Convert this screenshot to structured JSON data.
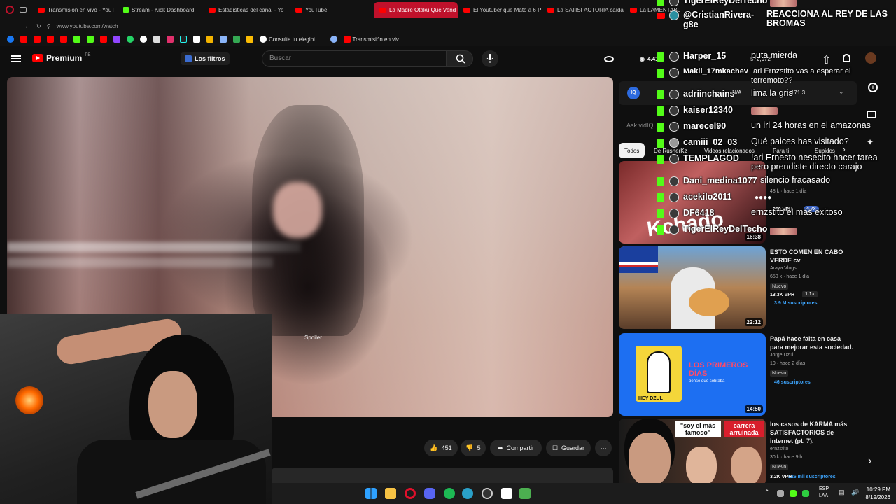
{
  "browser": {
    "tabs": [
      {
        "label": "Transmisión en vivo - YouT",
        "favicon": "youtube-icon",
        "active": false
      },
      {
        "label": "Stream - Kick Dashboard",
        "favicon": "kick-icon",
        "active": false
      },
      {
        "label": "Estadísticas del canal - Yo",
        "favicon": "youtube-icon",
        "active": false
      },
      {
        "label": "YouTube",
        "favicon": "youtube-icon",
        "active": false
      },
      {
        "label": "La Madre Otaku Que Vend",
        "favicon": "youtube-icon",
        "active": true
      },
      {
        "label": "El Youtuber que Mató a 6 P",
        "favicon": "youtube-icon",
        "active": false
      },
      {
        "label": "La SATISFACTORIA caída d",
        "favicon": "youtube-icon",
        "active": false
      },
      {
        "label": "La LAMENTABLE y HORRI",
        "favicon": "youtube-icon",
        "active": false
      }
    ],
    "url": "www.youtube.com/watch",
    "bookmarks": {
      "item1": "Consulta tu elegibi...",
      "item2": "Transmisión en viv..."
    }
  },
  "youtube": {
    "logo_text": "Premium",
    "logo_region": "PE",
    "filter_label": "Los filtros",
    "search_placeholder": "Buscar",
    "views_count": "4.41",
    "subs_count": "572,972",
    "ask_placeholder": "Ask vidIQ",
    "vidiq_na": "N/A",
    "vidiq_score": "171.3"
  },
  "video": {
    "spoiler_text": "Spoiler",
    "actions": {
      "likes": "451",
      "dislikes": "5",
      "share": "Compartir",
      "save": "Guardar"
    }
  },
  "chips": [
    {
      "label": "Todos",
      "active": true
    },
    {
      "label": "De RusherKz",
      "active": false
    },
    {
      "label": "Videos relacionados",
      "active": false
    },
    {
      "label": "Para ti",
      "active": false
    },
    {
      "label": "Subidos",
      "active": false
    }
  ],
  "recommendations": [
    {
      "title": "",
      "duration": "16:38",
      "thumb_word": "Kchado",
      "meta_views": "48 k",
      "meta_age": "hace 1 día",
      "vph": "250 VPH",
      "mult": "4.7x"
    },
    {
      "title": "ESTO COMEN EN CABO VERDE cv",
      "channel": "Araya Vlogs",
      "meta_views": "650 k",
      "meta_age": "hace 1 día",
      "badge": "Nuevo",
      "vph": "13.3K VPH",
      "mult": "1.1x",
      "subs": "3.9 M suscriptores",
      "duration": "22:12"
    },
    {
      "title": "Papá hace falta en casa para mejorar esta sociedad.",
      "channel": "Jorge Dzul",
      "meta_views": "10",
      "meta_age": "hace 2 días",
      "badge": "Nuevo",
      "subs": "46 suscriptores",
      "duration": "14:50",
      "thumb_title": "LOS PRIMEROS DÍAS",
      "thumb_sub": "pensé que sobraba",
      "thumb_brand": "HEY DZUL"
    },
    {
      "title": "los casos de KARMA más SATISFACTORIOS de internet (pt. 7).",
      "channel": "ernzstito",
      "meta_views": "30 k",
      "meta_age": "hace 9 h",
      "badge": "Nuevo",
      "vph": "3.2K VPH",
      "subs": "126 mil suscriptores",
      "thumb_tag1": "\"soy el más famoso\"",
      "thumb_tag2": "carrera arruinada"
    }
  ],
  "chat": [
    {
      "user": "TigerElReyDelTecho",
      "msg": "",
      "platform": "kick",
      "emote": true
    },
    {
      "user": "@CristianRivera-g8e",
      "msg": "REACCIONA AL REY DE LAS BROMAS",
      "platform": "youtube",
      "emote": false
    },
    {
      "user": "Harper_15",
      "msg": "puta mierda",
      "platform": "kick",
      "emote": false
    },
    {
      "user": "Makii_17mkachev",
      "msg": "!ari Ernzstito vas a esperar el terremoto??",
      "platform": "kick",
      "emote": false
    },
    {
      "user": "adriinchains",
      "msg": "lima la gris",
      "platform": "kick",
      "emote": false
    },
    {
      "user": "kaiser12340",
      "msg": "",
      "platform": "kick",
      "emote": true
    },
    {
      "user": "marecel90",
      "msg": "un irl 24 horas en el amazonas",
      "platform": "kick",
      "emote": false
    },
    {
      "user": "camiii_02_03",
      "msg": "Qué paices has visitado?",
      "platform": "kick",
      "emote": false
    },
    {
      "user": "TEMPLAGOD",
      "msg": "!ari Ernesto nesecito hacer tarea pero prendiste directo carajo",
      "platform": "kick",
      "emote": false
    },
    {
      "user": "Dani_medina1077",
      "msg": "silencio fracasado",
      "platform": "kick",
      "emote": false
    },
    {
      "user": "acekilo2011",
      "msg": "",
      "platform": "kick",
      "emote": false
    },
    {
      "user": "DF6418",
      "msg": "ernzstito el más exitoso",
      "platform": "kick",
      "emote": false
    },
    {
      "user": "TigerElReyDelTecho",
      "msg": "",
      "platform": "kick",
      "emote": true
    }
  ],
  "taskbar": {
    "lang": "ESP",
    "lang2": "LAA",
    "time": "10:29 PM",
    "date": "8/19/2026"
  },
  "colors": {
    "accent": "#ff0000",
    "kick": "#53fc18",
    "active_tab": "#c0112b",
    "link": "#3ea6ff"
  }
}
